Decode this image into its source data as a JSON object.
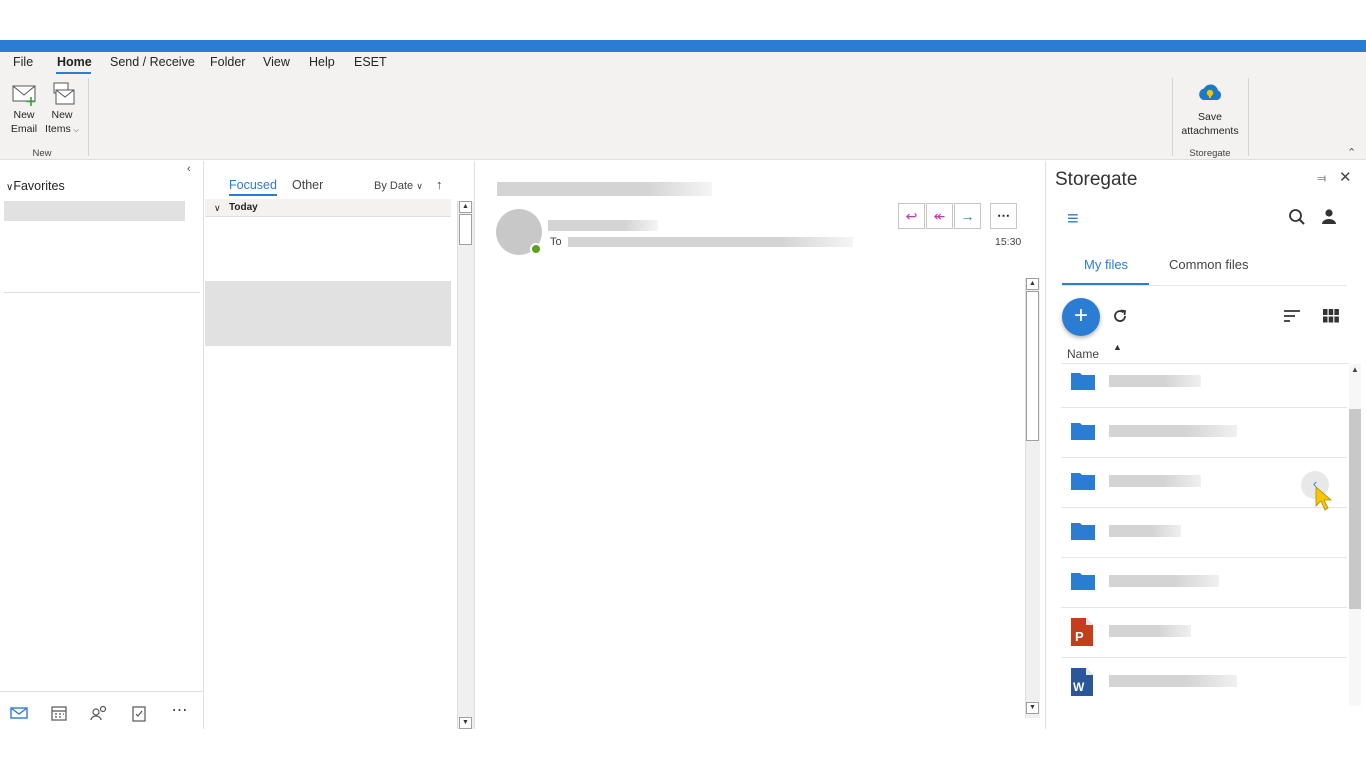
{
  "menu": {
    "items": [
      "File",
      "Home",
      "Send / Receive",
      "Folder",
      "View",
      "Help",
      "ESET"
    ],
    "active": "Home"
  },
  "ribbon": {
    "new_email": "New\nEmail",
    "new_email_l1": "New",
    "new_email_l2": "Email",
    "new_items_l1": "New",
    "new_items_l2": "Items",
    "group_new": "New",
    "save_attachments_l1": "Save",
    "save_attachments_l2": "attachments",
    "group_storegate": "Storegate"
  },
  "leftnav": {
    "favorites": "Favorites"
  },
  "messagelist": {
    "tab_focused": "Focused",
    "tab_other": "Other",
    "sort_label": "By Date",
    "group_today": "Today"
  },
  "reading": {
    "to_label": "To",
    "time": "15:30"
  },
  "storegate": {
    "title": "Storegate",
    "tab_my_files": "My files",
    "tab_common_files": "Common files",
    "column_name": "Name",
    "accent": "#2b7cd3",
    "files": [
      {
        "type": "folder"
      },
      {
        "type": "folder"
      },
      {
        "type": "folder",
        "shared_hover": true
      },
      {
        "type": "folder"
      },
      {
        "type": "folder"
      },
      {
        "type": "powerpoint",
        "letter": "P"
      },
      {
        "type": "word",
        "letter": "W"
      }
    ]
  }
}
